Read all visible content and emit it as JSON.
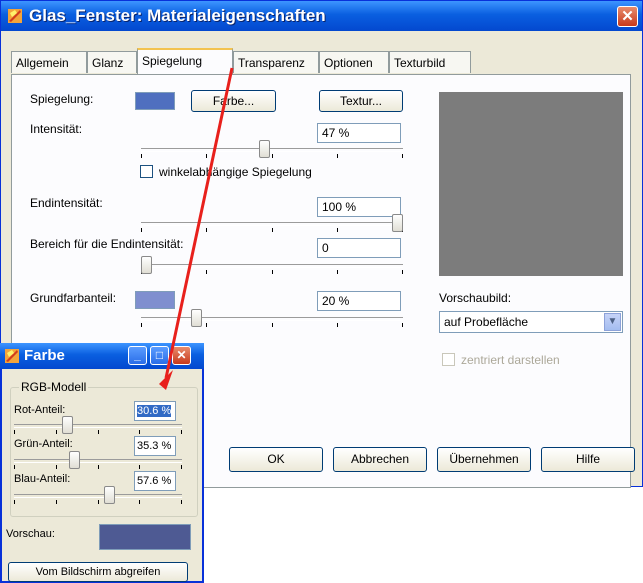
{
  "window": {
    "title": "Glas_Fenster: Materialeigenschaften",
    "close_glyph": "✕",
    "tabs": [
      "Allgemein",
      "Glanz",
      "Spiegelung",
      "Transparenz",
      "Optionen",
      "Texturbild"
    ],
    "active_tab": "Spiegelung"
  },
  "spiegelung": {
    "label": "Spiegelung:",
    "swatch_color": "#4f6fbf",
    "farbe_button": "Farbe...",
    "textur_button": "Textur...",
    "intensitaet_label": "Intensität:",
    "intensitaet_value": "47 %",
    "intensitaet_level": 0.47,
    "winkel_label": "winkelabhängige Spiegelung",
    "winkel_checked": false,
    "endintensitaet_label": "Endintensität:",
    "endintensitaet_value": "100 %",
    "endintensitaet_level": 1.0,
    "bereich_label": "Bereich für die Endintensität:",
    "bereich_value": "0",
    "bereich_level": 0.0,
    "grundfarbanteil_label": "Grundfarbanteil:",
    "grundfarbanteil_swatch": "#7f8fcf",
    "grundfarbanteil_value": "20 %",
    "grundfarbanteil_level": 0.2,
    "preview_color": "#7c7c7c",
    "vorschaubild_label": "Vorschaubild:",
    "vorschaubild_value": "auf Probefläche",
    "zentriert_label": "zentriert darstellen"
  },
  "footer": {
    "ok": "OK",
    "abbrechen": "Abbrechen",
    "uebernehmen": "Übernehmen",
    "hilfe": "Hilfe"
  },
  "farbe_dialog": {
    "title": "Farbe",
    "group_title": "RGB-Modell",
    "rot_label": "Rot-Anteil:",
    "rot_value": "30.6 %",
    "rot_level": 0.306,
    "gruen_label": "Grün-Anteil:",
    "gruen_value": "35.3 %",
    "gruen_level": 0.353,
    "blau_label": "Blau-Anteil:",
    "blau_value": "57.6 %",
    "blau_level": 0.576,
    "vorschau_label": "Vorschau:",
    "vorschau_color": "#4e5a93",
    "pick_button": "Vom Bildschirm abgreifen",
    "minimize_glyph": "_",
    "maximize_glyph": "□",
    "close_glyph": "✕"
  },
  "colors": {
    "annotation_arrow": "#e8201c",
    "titlebar": "#0a5fe0"
  }
}
